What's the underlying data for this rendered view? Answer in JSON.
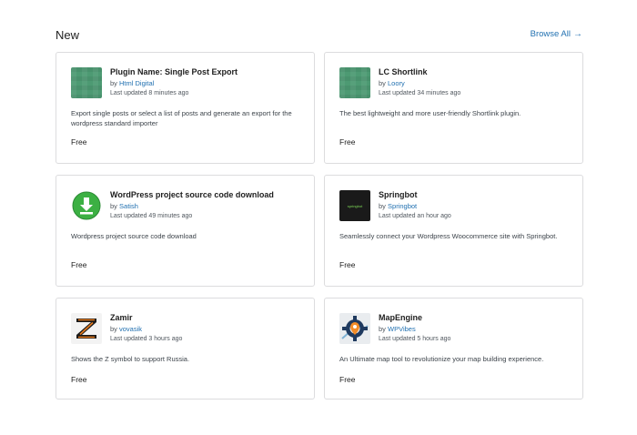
{
  "header": {
    "section_title": "New",
    "browse_all": "Browse All"
  },
  "plugins": [
    {
      "name": "Plugin Name: Single Post Export",
      "by_prefix": "by",
      "author": "Html Digital",
      "updated": "Last updated 8 minutes ago",
      "description": "Export single posts or select a list of posts and generate an export for the wordpress standard importer",
      "price": "Free",
      "icon": "green-pattern-icon"
    },
    {
      "name": "LC Shortlink",
      "by_prefix": "by",
      "author": "Loory",
      "updated": "Last updated 34 minutes ago",
      "description": "The best lightweight and more user-friendly Shortlink plugin.",
      "price": "Free",
      "icon": "green-pattern-icon"
    },
    {
      "name": "WordPress project source code download",
      "by_prefix": "by",
      "author": "Satish",
      "updated": "Last updated 49 minutes ago",
      "description": "Wordpress project source code download",
      "price": "Free",
      "icon": "download-icon"
    },
    {
      "name": "Springbot",
      "by_prefix": "by",
      "author": "Springbot",
      "updated": "Last updated an hour ago",
      "description": "Seamlessly connect your Wordpress Woocommerce site with Springbot.",
      "price": "Free",
      "icon": "springbot-logo-icon",
      "icon_text": "springbot"
    },
    {
      "name": "Zamir",
      "by_prefix": "by",
      "author": "vovasik",
      "updated": "Last updated 3 hours ago",
      "description": "Shows the Z symbol to support Russia.",
      "price": "Free",
      "icon": "z-symbol-icon"
    },
    {
      "name": "MapEngine",
      "by_prefix": "by",
      "author": "WPVibes",
      "updated": "Last updated 5 hours ago",
      "description": "An Ultimate map tool to revolutionize your map building experience.",
      "price": "Free",
      "icon": "map-gear-icon"
    }
  ],
  "colors": {
    "link": "#2271b1",
    "border": "#dcdcde",
    "thumb_green": "#4d9a73",
    "download_green": "#3cb043",
    "z_orange": "#e87b1c"
  }
}
